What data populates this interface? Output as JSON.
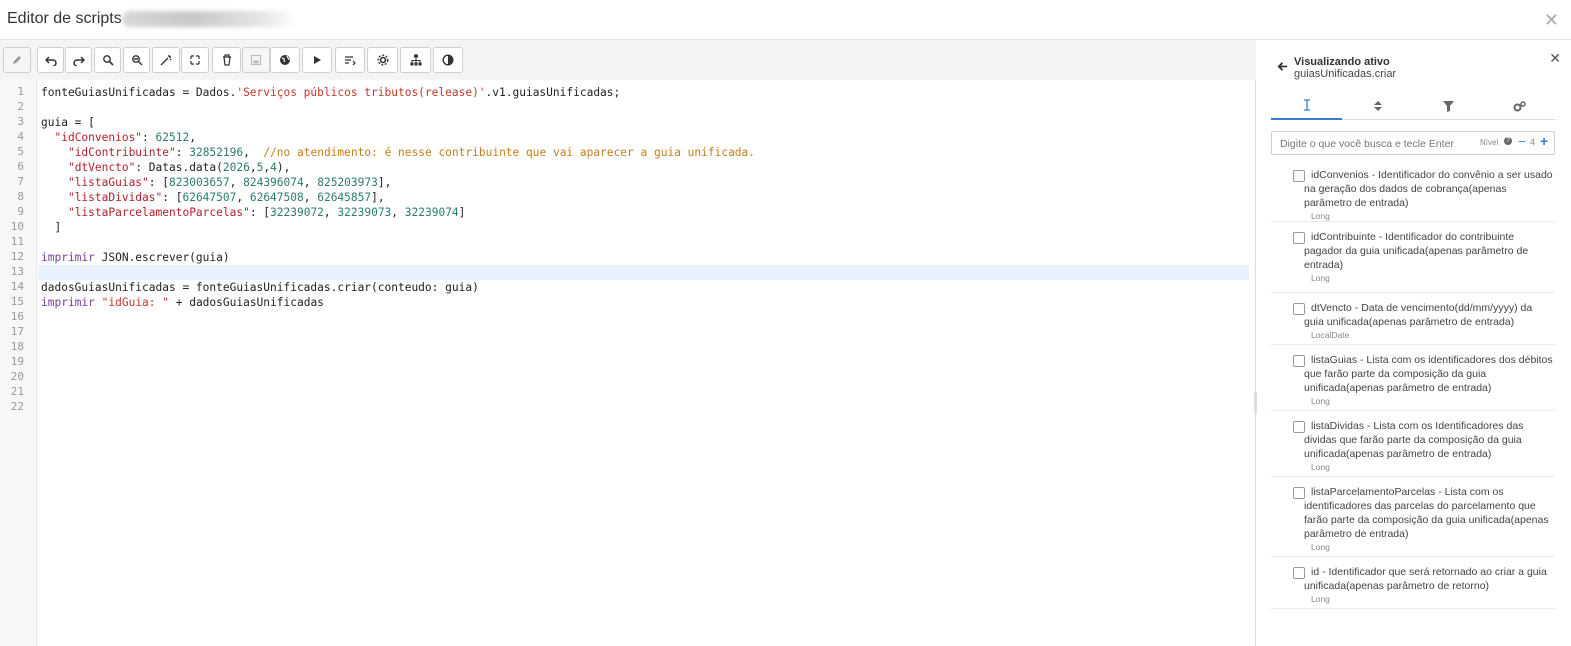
{
  "window": {
    "title": "Editor de scripts"
  },
  "toolbar": {
    "buttons": [
      {
        "name": "edit",
        "icon": "pencil-icon"
      },
      {
        "name": "undo",
        "icon": "undo-icon"
      },
      {
        "name": "redo",
        "icon": "redo-icon"
      },
      {
        "name": "search",
        "icon": "search-icon"
      },
      {
        "name": "search-replace",
        "icon": "search-replace-icon"
      },
      {
        "name": "magic",
        "icon": "magic-wand-icon"
      },
      {
        "name": "expand",
        "icon": "expand-icon"
      },
      {
        "name": "delete",
        "icon": "trash-icon"
      },
      {
        "name": "save",
        "icon": "save-icon"
      },
      {
        "name": "globe",
        "icon": "globe-icon"
      },
      {
        "name": "run",
        "icon": "play-icon"
      },
      {
        "name": "format",
        "icon": "format-icon"
      },
      {
        "name": "settings",
        "icon": "gear-icon"
      },
      {
        "name": "hierarchy",
        "icon": "sitemap-icon"
      },
      {
        "name": "contrast",
        "icon": "contrast-icon"
      }
    ]
  },
  "editor": {
    "line_numbers": [
      "1",
      "2",
      "3",
      "4",
      "5",
      "6",
      "7",
      "8",
      "9",
      "10",
      "11",
      "12",
      "13",
      "14",
      "15",
      "16",
      "17",
      "18",
      "19",
      "20",
      "21",
      "22"
    ],
    "highlighted_line": "13",
    "lines": [
      [
        {
          "t": "fonteGuiasUnificadas = Dados."
        },
        {
          "t": "'Serviços públicos tributos(release)'",
          "c": "str"
        },
        {
          "t": ".v1.guiasUnificadas;"
        }
      ],
      [],
      [
        {
          "t": "guia = ["
        }
      ],
      [
        {
          "t": "  "
        },
        {
          "t": "\"idConvenios\"",
          "c": "key"
        },
        {
          "t": ": "
        },
        {
          "t": "62512",
          "c": "num"
        },
        {
          "t": ","
        }
      ],
      [
        {
          "t": "    "
        },
        {
          "t": "\"idContribuinte\"",
          "c": "key"
        },
        {
          "t": ": "
        },
        {
          "t": "32852196",
          "c": "num"
        },
        {
          "t": ",  "
        },
        {
          "t": "//no atendimento: é nesse contribuinte que vai aparecer a guia unificada.",
          "c": "cmt"
        }
      ],
      [
        {
          "t": "    "
        },
        {
          "t": "\"dtVencto\"",
          "c": "key"
        },
        {
          "t": ": Datas.data("
        },
        {
          "t": "2026",
          "c": "num"
        },
        {
          "t": ","
        },
        {
          "t": "5",
          "c": "num"
        },
        {
          "t": ","
        },
        {
          "t": "4",
          "c": "num"
        },
        {
          "t": "),"
        }
      ],
      [
        {
          "t": "    "
        },
        {
          "t": "\"listaGuias\"",
          "c": "key"
        },
        {
          "t": ": ["
        },
        {
          "t": "823003657",
          "c": "num"
        },
        {
          "t": ", "
        },
        {
          "t": "824396074",
          "c": "num"
        },
        {
          "t": ", "
        },
        {
          "t": "825203973",
          "c": "num"
        },
        {
          "t": "],"
        }
      ],
      [
        {
          "t": "    "
        },
        {
          "t": "\"listaDividas\"",
          "c": "key"
        },
        {
          "t": ": ["
        },
        {
          "t": "62647507",
          "c": "num"
        },
        {
          "t": ", "
        },
        {
          "t": "62647508",
          "c": "num"
        },
        {
          "t": ", "
        },
        {
          "t": "62645857",
          "c": "num"
        },
        {
          "t": "],"
        }
      ],
      [
        {
          "t": "    "
        },
        {
          "t": "\"listaParcelamentoParcelas\"",
          "c": "key"
        },
        {
          "t": ": ["
        },
        {
          "t": "32239072",
          "c": "num"
        },
        {
          "t": ", "
        },
        {
          "t": "32239073",
          "c": "num"
        },
        {
          "t": ", "
        },
        {
          "t": "32239074",
          "c": "num"
        },
        {
          "t": "]"
        }
      ],
      [
        {
          "t": "  ]"
        }
      ],
      [],
      [
        {
          "t": "imprimir",
          "c": "kw"
        },
        {
          "t": " JSON.escrever(guia)"
        }
      ],
      [],
      [
        {
          "t": "dadosGuiasUnificadas = fonteGuiasUnificadas.criar(conteudo: guia)"
        }
      ],
      [
        {
          "t": "imprimir",
          "c": "kw"
        },
        {
          "t": " "
        },
        {
          "t": "\"idGuia: \"",
          "c": "str"
        },
        {
          "t": " + dadosGuiasUnificadas"
        }
      ],
      [],
      [],
      [],
      [],
      [],
      [],
      []
    ]
  },
  "side_panel": {
    "title": "Visualizando ativo",
    "subtitle": "guiasUnificadas.criar",
    "tabs": [
      {
        "icon": "text-cursor-icon",
        "active": true
      },
      {
        "icon": "sort-icon",
        "active": false
      },
      {
        "icon": "filter-icon",
        "active": false
      },
      {
        "icon": "gears-icon",
        "active": false
      }
    ],
    "search": {
      "placeholder": "Digite o que você busca e tecle Enter",
      "nivel_label": "Nível",
      "nivel_value": "4"
    },
    "fields": [
      {
        "desc": "idConvenios - Identificador do convênio a ser usado na geração dos dados de cobrança(apenas parâmetro de entrada)",
        "type": "Long"
      },
      {
        "desc": "idContribuinte - Identificador do contribuinte pagador da guia unificada(apenas parâmetro de entrada)",
        "type": "Long"
      },
      {
        "desc": "dtVencto - Data de vencimento(dd/mm/yyyy) da guia unificada(apenas parâmetro de entrada)",
        "type": "LocalDate"
      },
      {
        "desc": "listaGuias - Lista com os identificadores dos débitos que farão parte da composição da guia unificada(apenas parâmetro de entrada)",
        "type": "Long"
      },
      {
        "desc": "listaDividas - Lista com os Identificadores das dividas que farão parte da composição da guia unificada(apenas parâmetro de entrada)",
        "type": "Long"
      },
      {
        "desc": "listaParcelamentoParcelas - Lista com os identificadores das parcelas do parcelamento que farão parte da composição da guia unificada(apenas parâmetro de entrada)",
        "type": "Long"
      },
      {
        "desc": "id - Identificador que será retornado ao criar a guia unificada(apenas parâmetro de retorno)",
        "type": "Long"
      }
    ]
  },
  "colors": {
    "accent": "#3a7bd5",
    "highlight_line": "#e8f2ff",
    "string": "#c0392b",
    "number": "#2a7c6f",
    "keyword": "#7a3e9d",
    "comment": "#c87d1c"
  }
}
